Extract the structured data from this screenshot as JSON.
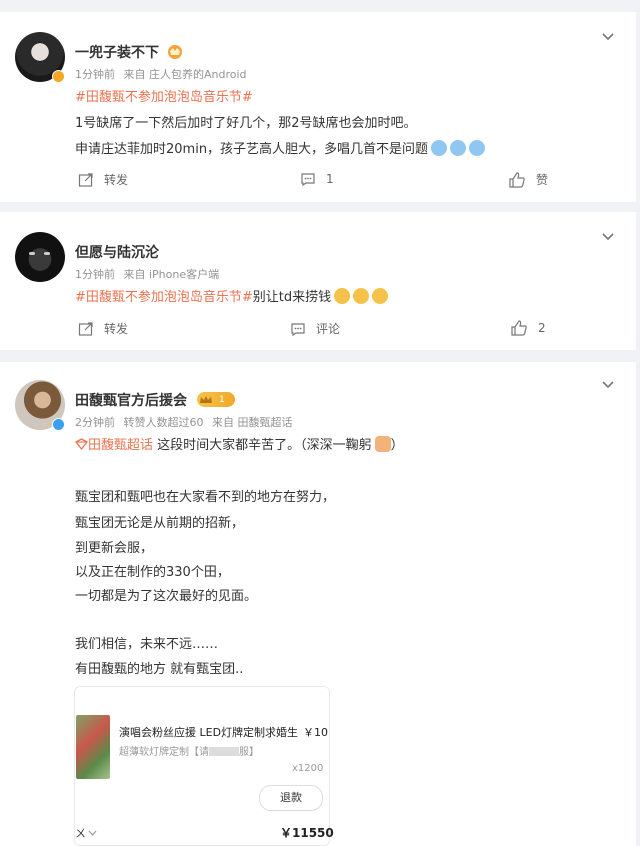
{
  "posts": [
    {
      "name": "一兜子装不下",
      "time": "1分钟前",
      "source": "来自 庄人包养的Android",
      "hashtag": "#田馥甄不参加泡泡岛音乐节#",
      "line1": "1号缺席了一下然后加时了好几个，那2号缺席也会加时吧。",
      "line2": "申请庄达菲加时20min，孩子艺高人胆大，多唱几首不是问题",
      "repost": "转发",
      "comment_count": "1",
      "like": "赞"
    },
    {
      "name": "但愿与陆沉沦",
      "time": "1分钟前",
      "source": "来自 iPhone客户端",
      "hashtag": "#田馥甄不参加泡泡岛音乐节#",
      "text_after": "别让td来捞钱",
      "repost": "转发",
      "comment": "评论",
      "like_count": "2"
    },
    {
      "name": "田馥甄官方后援会",
      "badge_level": "1",
      "time": "2分钟前",
      "repost_info": "转赞人数超过60",
      "source": "来自 田馥甄超话",
      "supertopic": "田馥甄超话",
      "text_after_topic": " 这段时间大家都辛苦了。（深深一鞠躬",
      "close_paren": "）",
      "lines": [
        "甄宝团和甄吧也在大家看不到的地方在努力，",
        "甄宝团无论是从前期的招新，",
        "到更新会服，",
        "以及正在制作的330个田，",
        "一切都是为了这次最好的见面。"
      ],
      "lines2": [
        "我们相信，未来不远……",
        "有田馥甄的地方 就有甄宝团.."
      ],
      "product": {
        "title": "演唱会粉丝应援 LED灯牌定制求婚生",
        "price_unit": "￥10",
        "spec": "超薄软灯牌定制【请",
        "spec_tail": "服】",
        "qty": "x1200",
        "refund_button": "退款",
        "total": "￥11550",
        "footer_prefix": "ㄨ"
      }
    }
  ],
  "colors": {
    "accent": "#eb7350",
    "meta": "#939393",
    "verified": "#f5a623",
    "verified_blue": "#3a9fef"
  }
}
